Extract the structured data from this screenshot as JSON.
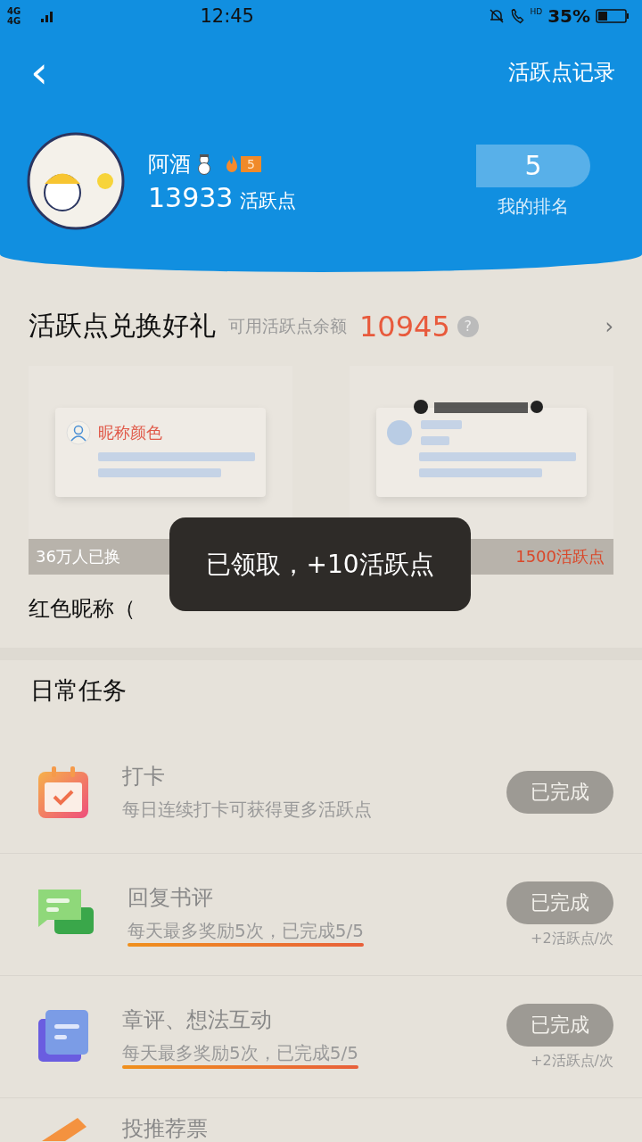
{
  "status_bar": {
    "network": "4G 4G",
    "time": "12:45",
    "call_hd": "HD",
    "battery": "35%"
  },
  "header": {
    "back": "‹",
    "record_link": "活跃点记录",
    "user": {
      "name": "阿酒",
      "level": "5",
      "points": "13933",
      "points_unit": "活跃点"
    },
    "rank": {
      "value": "5",
      "label": "我的排名"
    }
  },
  "exchange": {
    "title": "活跃点兑换好礼",
    "balance_label": "可用活跃点余额",
    "balance": "10945",
    "help": "?",
    "more": "›",
    "items": [
      {
        "preview_label": "昵称颜色",
        "count": "36万人已换",
        "name": "红色昵称（",
        "kind": "nickname"
      },
      {
        "price": "1500活跃点",
        "kind": "banner"
      }
    ]
  },
  "toast": "已领取，+10活跃点",
  "daily": {
    "title": "日常任务",
    "tasks": [
      {
        "kind": "calendar",
        "title": "打卡",
        "desc": "每日连续打卡可获得更多活跃点",
        "underlined": false,
        "button": "已完成",
        "done": true
      },
      {
        "kind": "chat",
        "title": "回复书评",
        "desc": "每天最多奖励5次，已完成5/5",
        "underlined": true,
        "button": "已完成",
        "done": true,
        "reward": "+2活跃点/次"
      },
      {
        "kind": "note",
        "title": "章评、想法互动",
        "desc": "每天最多奖励5次，已完成5/5",
        "underlined": true,
        "button": "已完成",
        "done": true,
        "reward": "+2活跃点/次"
      },
      {
        "kind": "ticket",
        "title": "投推荐票"
      }
    ]
  }
}
